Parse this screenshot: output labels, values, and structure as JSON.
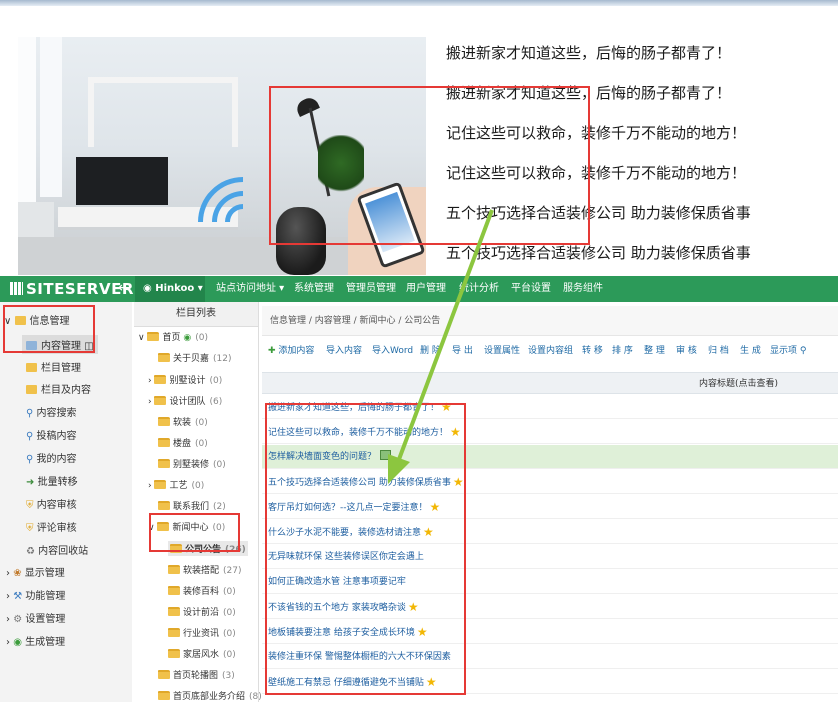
{
  "articles": [
    "搬进新家才知道这些，后悔的肠子都青了！",
    "搬进新家才知道这些，后悔的肠子都青了！",
    "记住这些可以救命，装修千万不能动的地方！",
    "记住这些可以救命，装修千万不能动的地方！",
    "五个技巧选择合适装修公司 助力装修保质省事",
    "五个技巧选择合适装修公司 助力装修保质省事"
  ],
  "navbar": {
    "logo": "SITESERVER",
    "back_icon": "arrow-left-icon",
    "site": "Hinkoo",
    "menu": [
      "站点访问地址",
      "系统管理",
      "管理员管理",
      "用户管理",
      "统计分析",
      "平台设置",
      "服务组件"
    ]
  },
  "leftnav": [
    {
      "label": "信息管理",
      "icon": "folder-icon"
    },
    {
      "label": "内容管理",
      "icon": "content-icon"
    },
    {
      "label": "栏目管理",
      "icon": "folder-icon"
    },
    {
      "label": "栏目及内容",
      "icon": "folder-icon"
    },
    {
      "label": "内容搜索",
      "icon": "search-icon"
    },
    {
      "label": "投稿内容",
      "icon": "search-icon"
    },
    {
      "label": "我的内容",
      "icon": "search-icon"
    },
    {
      "label": "批量转移",
      "icon": "transfer-icon"
    },
    {
      "label": "内容审核",
      "icon": "shield-icon"
    },
    {
      "label": "评论审核",
      "icon": "shield-icon"
    },
    {
      "label": "内容回收站",
      "icon": "recycle-icon"
    },
    {
      "label": "显示管理",
      "icon": "display-icon"
    },
    {
      "label": "功能管理",
      "icon": "wrench-icon"
    },
    {
      "label": "设置管理",
      "icon": "gear-icon"
    },
    {
      "label": "生成管理",
      "icon": "globe-icon"
    }
  ],
  "tree": {
    "header": "栏目列表",
    "nodes": [
      {
        "label": "首页",
        "count": "(0)"
      },
      {
        "label": "关于贝嘉",
        "count": "(12)"
      },
      {
        "label": "别墅设计",
        "count": "(0)"
      },
      {
        "label": "设计团队",
        "count": "(6)"
      },
      {
        "label": "软装",
        "count": "(0)"
      },
      {
        "label": "楼盘",
        "count": "(0)"
      },
      {
        "label": "别墅装修",
        "count": "(0)"
      },
      {
        "label": "工艺",
        "count": "(0)"
      },
      {
        "label": "联系我们",
        "count": "(2)"
      },
      {
        "label": "新闻中心",
        "count": "(0)"
      },
      {
        "label": "公司公告",
        "count": "(26)"
      },
      {
        "label": "软装搭配",
        "count": "(27)"
      },
      {
        "label": "装修百科",
        "count": "(0)"
      },
      {
        "label": "设计前沿",
        "count": "(0)"
      },
      {
        "label": "行业资讯",
        "count": "(0)"
      },
      {
        "label": "家居风水",
        "count": "(0)"
      },
      {
        "label": "首页轮播图",
        "count": "(3)"
      },
      {
        "label": "首页底部业务介绍",
        "count": "(8)"
      }
    ]
  },
  "breadcrumb": "信息管理 / 内容管理 / 新闻中心 / 公司公告",
  "toolbar": [
    "添加内容",
    "导入内容",
    "导入Word",
    "删 除",
    "导 出",
    "设置属性",
    "设置内容组",
    "转 移",
    "排 序",
    "整 理",
    "审 核",
    "归 档",
    "生 成",
    "显示项"
  ],
  "table": {
    "header": "内容标题(点击查看)",
    "rows": [
      "搬进新家才知道这些，后悔的肠子都青了！",
      "记住这些可以救命，装修千万不能动的地方！",
      "怎样解决墙面变色的问题？",
      "五个技巧选择合适装修公司 助力装修保质省事",
      "客厅吊灯如何选？--这几点一定要注意！",
      "什么沙子水泥不能要，装修选材请注意",
      "无异味就环保 这些装修误区你定会遇上",
      "如何正确改造水管 注意事项要记牢",
      "不该省钱的五个地方 家装攻略杂谈",
      "地板铺装要注意 给孩子安全成长环境",
      "装修注重环保 警惕整体橱柜的六大不环保因素",
      "壁纸施工有禁忌 仔细遵循避免不当铺贴"
    ]
  },
  "colors": {
    "navbar": "#2c9a59",
    "highlight": "#e53935",
    "arrow": "#8cc63f",
    "link": "#1f5fa0"
  }
}
